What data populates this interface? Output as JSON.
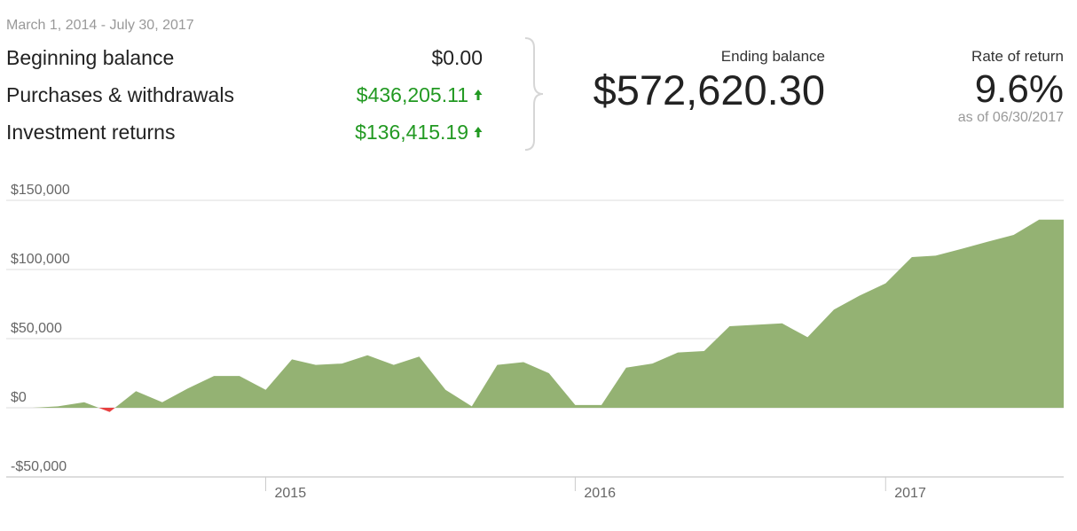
{
  "header": {
    "date_range": "March 1, 2014 - July 30, 2017"
  },
  "summary": {
    "beginning_label": "Beginning balance",
    "beginning_value": "$0.00",
    "purchases_label": "Purchases & withdrawals",
    "purchases_value": "$436,205.11",
    "returns_label": "Investment returns",
    "returns_value": "$136,415.19"
  },
  "ending": {
    "label": "Ending balance",
    "value": "$572,620.30"
  },
  "rate": {
    "label": "Rate of return",
    "value": "9.6%",
    "as_of": "as of 06/30/2017"
  },
  "colors": {
    "positive_fill": "#94b273",
    "negative_fill": "#e84040",
    "gain_text": "#229922"
  },
  "chart_data": {
    "type": "area",
    "y_ticks": [
      {
        "value": 150000,
        "label": "$150,000"
      },
      {
        "value": 100000,
        "label": "$100,000"
      },
      {
        "value": 50000,
        "label": "$50,000"
      },
      {
        "value": 0,
        "label": "$0"
      },
      {
        "value": -50000,
        "label": "-$50,000"
      }
    ],
    "ylim": [
      -50000,
      150000
    ],
    "x_ticks": [
      {
        "date": "2015-01-01",
        "label": "2015"
      },
      {
        "date": "2016-01-01",
        "label": "2016"
      },
      {
        "date": "2017-01-01",
        "label": "2017"
      }
    ],
    "xlim": [
      "2014-03-01",
      "2017-07-30"
    ],
    "points": [
      [
        "2014-03-01",
        0
      ],
      [
        "2014-04-01",
        0
      ],
      [
        "2014-05-01",
        1000
      ],
      [
        "2014-06-01",
        4000
      ],
      [
        "2014-07-01",
        -3000
      ],
      [
        "2014-08-01",
        12000
      ],
      [
        "2014-09-01",
        4000
      ],
      [
        "2014-10-01",
        14000
      ],
      [
        "2014-11-01",
        23000
      ],
      [
        "2014-12-01",
        23000
      ],
      [
        "2015-01-01",
        13000
      ],
      [
        "2015-02-01",
        35000
      ],
      [
        "2015-03-01",
        31000
      ],
      [
        "2015-04-01",
        32000
      ],
      [
        "2015-05-01",
        38000
      ],
      [
        "2015-06-01",
        31000
      ],
      [
        "2015-07-01",
        37000
      ],
      [
        "2015-08-01",
        13000
      ],
      [
        "2015-09-01",
        1000
      ],
      [
        "2015-10-01",
        31000
      ],
      [
        "2015-11-01",
        33000
      ],
      [
        "2015-12-01",
        25000
      ],
      [
        "2016-01-01",
        2000
      ],
      [
        "2016-02-01",
        2000
      ],
      [
        "2016-03-01",
        29000
      ],
      [
        "2016-04-01",
        32000
      ],
      [
        "2016-05-01",
        40000
      ],
      [
        "2016-06-01",
        41000
      ],
      [
        "2016-07-01",
        59000
      ],
      [
        "2016-08-01",
        60000
      ],
      [
        "2016-09-01",
        61000
      ],
      [
        "2016-10-01",
        51000
      ],
      [
        "2016-11-01",
        71000
      ],
      [
        "2016-12-01",
        81000
      ],
      [
        "2017-01-01",
        90000
      ],
      [
        "2017-02-01",
        109000
      ],
      [
        "2017-03-01",
        110000
      ],
      [
        "2017-04-01",
        115000
      ],
      [
        "2017-05-01",
        120000
      ],
      [
        "2017-06-01",
        125000
      ],
      [
        "2017-07-01",
        136000
      ]
    ],
    "grid": true
  }
}
